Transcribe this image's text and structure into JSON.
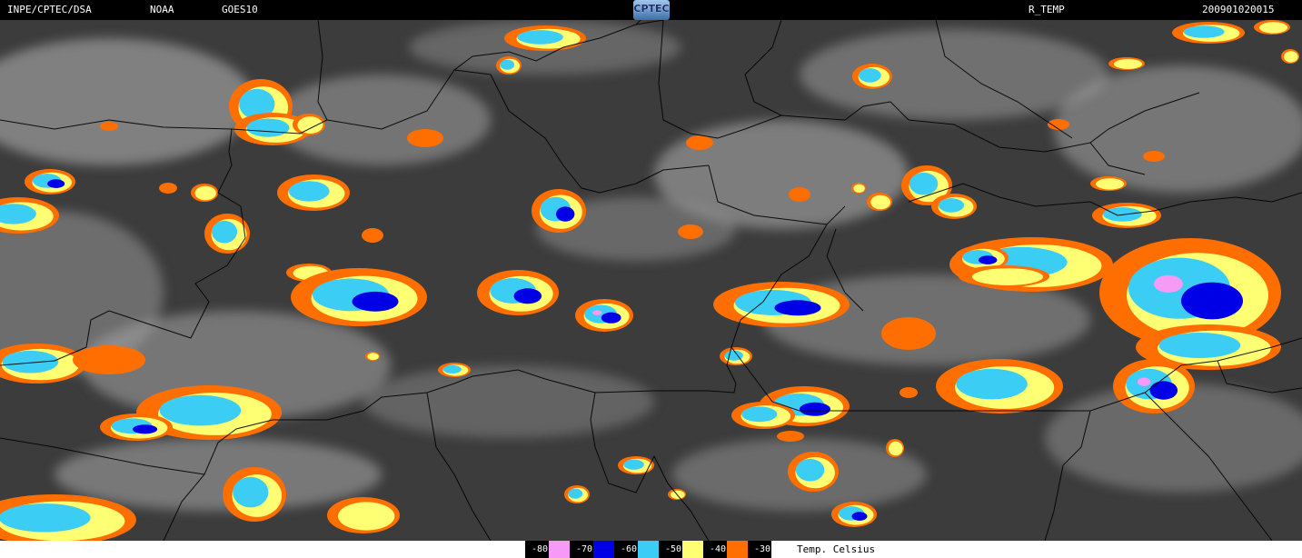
{
  "header": {
    "source": "INPE/CPTEC/DSA",
    "agency": "NOAA",
    "satellite": "GOES10",
    "logo_text": "CPTEC",
    "product": "R_TEMP",
    "timestamp": "200901020015"
  },
  "legend": {
    "title": "Temp. Celsius",
    "items": [
      {
        "label": "-80",
        "color": "#f59af5"
      },
      {
        "label": "-70",
        "color": "#0000e6"
      },
      {
        "label": "-60",
        "color": "#3ccdf5"
      },
      {
        "label": "-50",
        "color": "#ffff73"
      },
      {
        "label": "-40",
        "color": "#ff6e00"
      },
      {
        "label": "-30",
        "color": "#ffffff"
      }
    ]
  },
  "colors": {
    "ground_dark": "#3c3c3c",
    "cloud_light": "#bdbdbd",
    "border_line": "#000000",
    "band_orange": "#ff6e00",
    "band_yellow": "#ffff73",
    "band_cyan": "#3ccdf5",
    "band_blue": "#0000e6",
    "band_pink": "#f59af5"
  }
}
